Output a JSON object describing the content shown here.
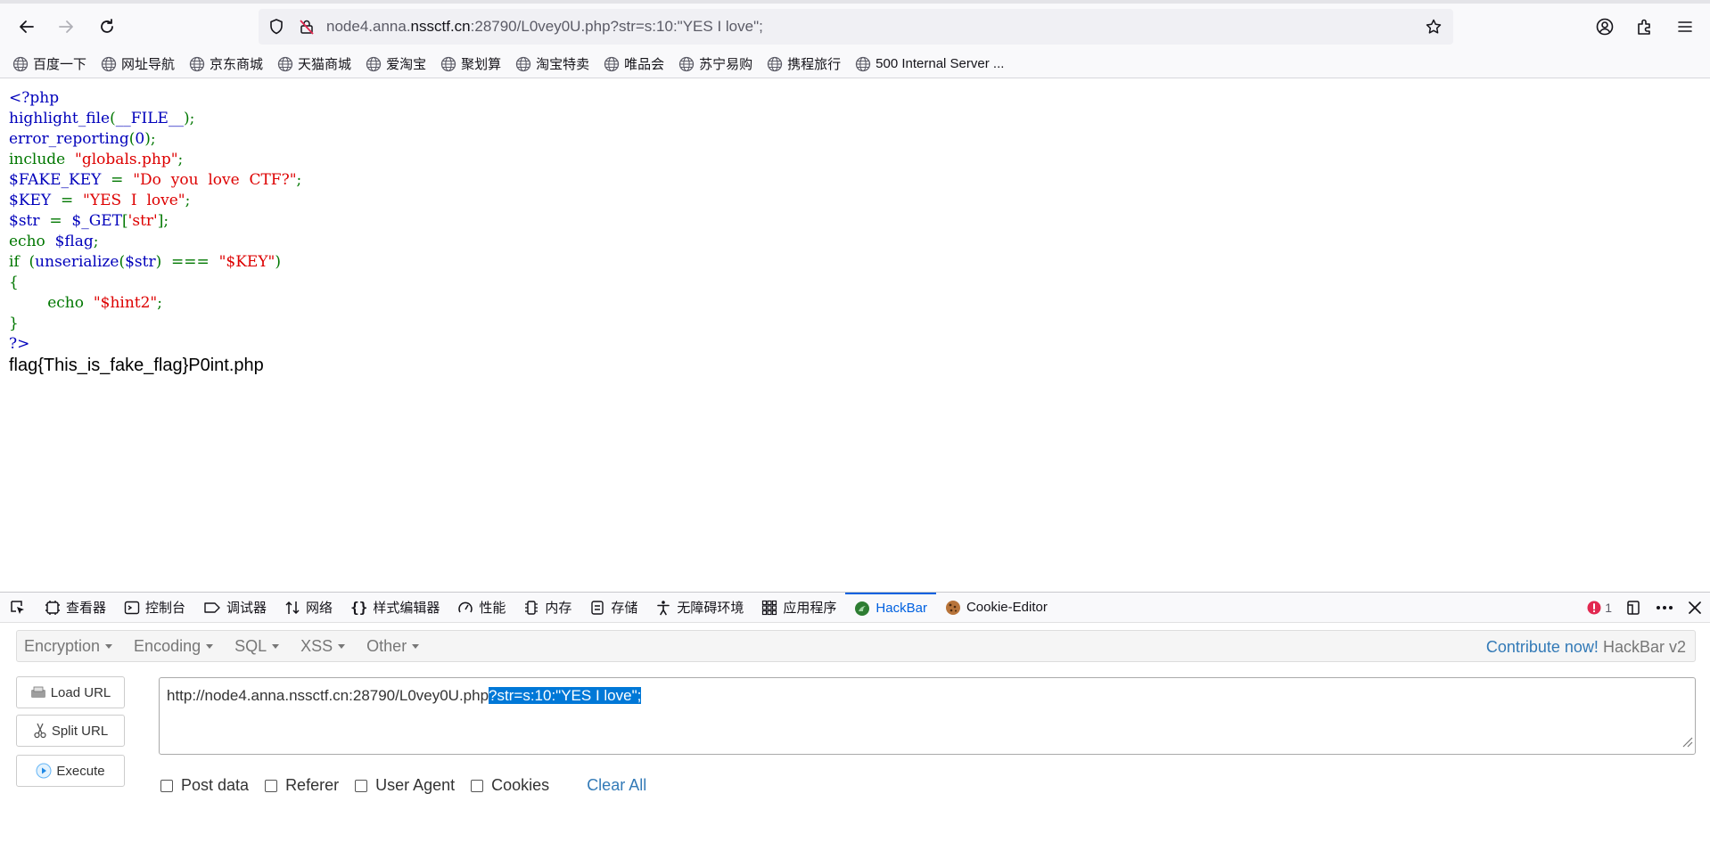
{
  "browser": {
    "url_prefix": "node4.anna.",
    "url_domain": "nssctf.cn",
    "url_suffix": ":28790/L0vey0U.php?str=s:10:\"YES I love\";"
  },
  "bookmarks": [
    "百度一下",
    "网址导航",
    "京东商城",
    "天猫商城",
    "爱淘宝",
    "聚划算",
    "淘宝特卖",
    "唯品会",
    "苏宁易购",
    "携程旅行",
    "500 Internal Server ..."
  ],
  "code_lines": [
    [
      {
        "c": "default",
        "t": "<?php"
      }
    ],
    [
      {
        "c": "default",
        "t": "highlight_file"
      },
      {
        "c": "kw",
        "t": "("
      },
      {
        "c": "default",
        "t": "__FILE__"
      },
      {
        "c": "kw",
        "t": ");"
      }
    ],
    [
      {
        "c": "default",
        "t": "error_reporting"
      },
      {
        "c": "kw",
        "t": "("
      },
      {
        "c": "default",
        "t": "0"
      },
      {
        "c": "kw",
        "t": ");"
      }
    ],
    [
      {
        "c": "kw",
        "t": "include  "
      },
      {
        "c": "str",
        "t": "\"globals.php\""
      },
      {
        "c": "kw",
        "t": ";"
      }
    ],
    [
      {
        "c": "default",
        "t": "$FAKE_KEY  "
      },
      {
        "c": "kw",
        "t": "=  "
      },
      {
        "c": "str",
        "t": "\"Do  you  love  CTF?\""
      },
      {
        "c": "kw",
        "t": ";"
      }
    ],
    [
      {
        "c": "default",
        "t": "$KEY  "
      },
      {
        "c": "kw",
        "t": "=  "
      },
      {
        "c": "str",
        "t": "\"YES  I  love\""
      },
      {
        "c": "kw",
        "t": ";"
      }
    ],
    [
      {
        "c": "default",
        "t": "$str  "
      },
      {
        "c": "kw",
        "t": "=  "
      },
      {
        "c": "default",
        "t": "$_GET"
      },
      {
        "c": "kw",
        "t": "["
      },
      {
        "c": "str",
        "t": "'str'"
      },
      {
        "c": "kw",
        "t": "];"
      }
    ],
    [
      {
        "c": "kw",
        "t": "echo  "
      },
      {
        "c": "default",
        "t": "$flag"
      },
      {
        "c": "kw",
        "t": ";"
      }
    ],
    [
      {
        "c": "kw",
        "t": "if  ("
      },
      {
        "c": "default",
        "t": "unserialize"
      },
      {
        "c": "kw",
        "t": "("
      },
      {
        "c": "default",
        "t": "$str"
      },
      {
        "c": "kw",
        "t": ")  ===  "
      },
      {
        "c": "str",
        "t": "\"$KEY\""
      },
      {
        "c": "kw",
        "t": ")"
      }
    ],
    [
      {
        "c": "kw",
        "t": "{"
      }
    ],
    [
      {
        "c": "kw",
        "t": "        echo  "
      },
      {
        "c": "str",
        "t": "\"$hint2\""
      },
      {
        "c": "kw",
        "t": ";"
      }
    ],
    [
      {
        "c": "kw",
        "t": "}"
      }
    ],
    [
      {
        "c": "default",
        "t": "?>"
      }
    ]
  ],
  "flag_output": "flag{This_is_fake_flag}P0int.php",
  "devtools": {
    "tabs": [
      "查看器",
      "控制台",
      "调试器",
      "网络",
      "样式编辑器",
      "性能",
      "内存",
      "存储",
      "无障碍环境",
      "应用程序",
      "HackBar",
      "Cookie-Editor"
    ],
    "active_tab": "HackBar",
    "error_count": "1"
  },
  "hackbar": {
    "menus": [
      "Encryption",
      "Encoding",
      "SQL",
      "XSS",
      "Other"
    ],
    "contribute": "Contribute now!",
    "version": "HackBar v2",
    "buttons": {
      "load": "Load URL",
      "split": "Split URL",
      "execute": "Execute"
    },
    "url_plain": "http://node4.anna.nssctf.cn:28790/L0vey0U.php",
    "url_selected": "?str=s:10:\"YES I love\";",
    "checks": [
      "Post data",
      "Referer",
      "User Agent",
      "Cookies"
    ],
    "clear_all": "Clear All"
  },
  "colors": {
    "accent": "#0061e0",
    "link": "#337ab7",
    "selection": "#0078d7"
  }
}
